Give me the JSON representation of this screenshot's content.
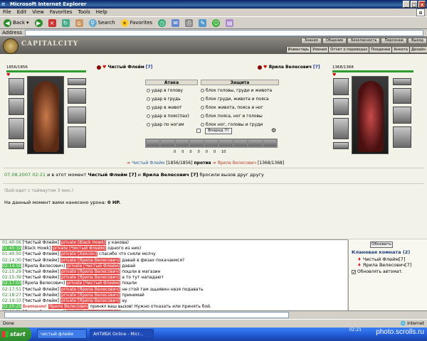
{
  "window": {
    "title": "Microsoft Internet Explorer"
  },
  "menu": [
    "File",
    "Edit",
    "View",
    "Favorites",
    "Tools",
    "Help"
  ],
  "toolbar": {
    "back": "Back",
    "search": "Search",
    "favorites": "Favorites"
  },
  "address": {
    "label": "Address",
    "value": ""
  },
  "site": {
    "logo": "CAPITALCITY",
    "topnav": [
      "Знания",
      "Общение",
      "Безопасность",
      "Персонаж",
      "Выход"
    ],
    "subnav": [
      "Инвентарь",
      "Умения",
      "Отчет о переводах",
      "Поединки",
      "Анкета",
      "Дизайн"
    ]
  },
  "fighters": {
    "left": {
      "name": "Чистый Флейм",
      "level": "[7]",
      "hp": "1856/1856",
      "hp_fraction": 1.0
    },
    "right": {
      "name": "Ярила Велесович",
      "level": "[7]",
      "hp": "1368/1368",
      "hp_fraction": 1.0
    }
  },
  "combat": {
    "attack_header": "Атака",
    "defense_header": "Защита",
    "attacks": [
      "удар в голову",
      "удар в грудь",
      "удар в живот",
      "удар в пояс(пах)",
      "удар по ногам"
    ],
    "defenses": [
      "блок головы, груди и живота",
      "блок груди, живота и пояса",
      "блок живота, пояса и ног",
      "блок пояса, ног и головы",
      "блок ног, головы и груди"
    ],
    "forward_button": "Вперед !!!",
    "stats": [
      "0",
      "0",
      "0",
      "0",
      "0",
      "0",
      "10"
    ]
  },
  "versus": {
    "left_name": "Чистый Флейм",
    "left_hp": "[1856/1856]",
    "word": "против",
    "right_name": "Ярила Велесович",
    "right_hp": "[1368/1368]"
  },
  "battle_log": {
    "line1_time": "07.08.2007 02:21",
    "line1_pre": "и в этот момент",
    "line1_name1": "Чистый Флейм [7]",
    "line1_and": "и",
    "line1_name2": "Ярила Велесович [7]",
    "line1_post": "бросили вызов друг другу",
    "line2": "(Бой идет с таймаутом 3 мин.)",
    "line3_pre": "На данный момент вами нанесено урона:",
    "line3_val": "0 HP."
  },
  "chat": [
    {
      "ts": "01:40:06",
      "hl": false,
      "name": "[Чистый Флейм]",
      "pv": "private [Black Howk]",
      "msg": "у какова)"
    },
    {
      "ts": "01:40:32",
      "hl": true,
      "name": "[Black Howk]",
      "pv": "private [Чистый Флейм]",
      "msg": "одного из них)"
    },
    {
      "ts": "01:40:50",
      "hl": false,
      "name": "[Чистый Флейм]",
      "pv": "private [Хексен]",
      "msg": "спасибо что сняли молчу"
    },
    {
      "ts": "02:14:30",
      "hl": false,
      "name": "[Чистый Флейм]",
      "pv": "private [Ярила Велесович]",
      "msg": "давай в физах покачаемся?"
    },
    {
      "ts": "02:14:50",
      "hl": true,
      "name": "[Ярила Велесович]",
      "pv": "private [Чистый Флейм]",
      "msg": "давай"
    },
    {
      "ts": "02:15:29",
      "hl": false,
      "name": "[Чистый Флейм]",
      "pv": "private [Ярила Велесович]",
      "msg": "пошли в магазин"
    },
    {
      "ts": "02:15:39",
      "hl": false,
      "name": "[Чистый Флейм]",
      "pv": "private [Ярила Велесович]",
      "msg": "а то тут нападают"
    },
    {
      "ts": "02:17:03",
      "hl": true,
      "name": "[Ярила Велесович]",
      "pv": "private [Чистый Флейм]",
      "msg": "пошли"
    },
    {
      "ts": "02:17:51",
      "hl": false,
      "name": "[Чистый Флейм]",
      "pv": "private [Ярила Велесович]",
      "msg": "не стой там зщаявкн нвзя подавать"
    },
    {
      "ts": "02:18:27",
      "hl": false,
      "name": "[Чистый Флейм]",
      "pv": "private [Ярила Велесович]",
      "msg": "принимай"
    },
    {
      "ts": "02:19:33",
      "hl": false,
      "name": "[Чистый Флейм]",
      "pv": "private [Ярила Велесович]",
      "msg": "ау"
    },
    {
      "ts": "02:20:25",
      "hl": true,
      "name": "",
      "warn": "Внимание!",
      "pv": "Ярила Велесович",
      "msg": "принял ваш вызов! Нужно отказать или принять бой."
    },
    {
      "ts": "02:20:31",
      "hl": false,
      "name": "[Ярила Велесович]",
      "pv": "private [Чистый Флейм]",
      "msg": "принемай"
    }
  ],
  "room": {
    "refresh": "Обновить",
    "title": "Клановая комната (2)",
    "members": [
      "Чистый Флейм[7]",
      "Ярила Велесович[7]"
    ],
    "auto": "Обновлять автомат."
  },
  "status": {
    "left": "Done",
    "zone": "Internet"
  },
  "taskbar": {
    "start": "start",
    "items": [
      "чистый флейм",
      "АНТИБК Online - Micr..."
    ],
    "clock": "02:21",
    "watermark": "photo.scrolls.ru"
  }
}
